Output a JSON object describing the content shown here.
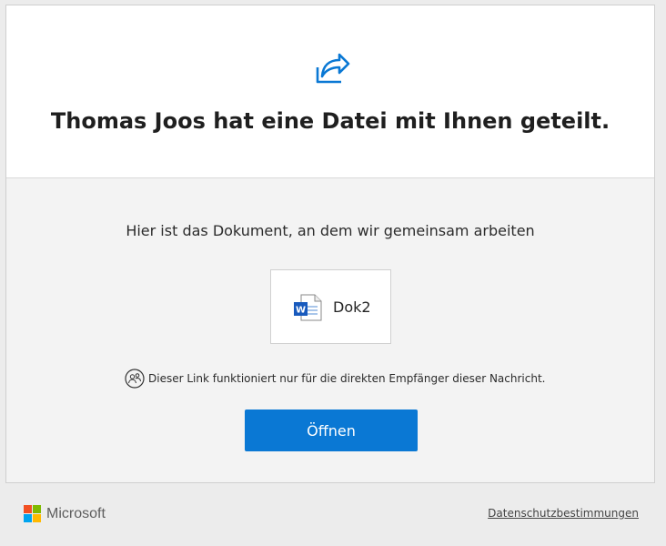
{
  "header": {
    "share_icon": "share-arrow-icon",
    "title": "Thomas Joos hat eine Datei mit Ihnen geteilt."
  },
  "body": {
    "message": "Hier ist das Dokument, an dem wir gemeinsam arbeiten",
    "document": {
      "icon": "word-document-icon",
      "name": "Dok2"
    },
    "link_notice": {
      "icon": "people-icon",
      "text": "Dieser Link funktioniert nur für die direkten Empfänger dieser Nachricht."
    },
    "open_button_label": "Öffnen"
  },
  "footer": {
    "brand": "Microsoft",
    "privacy_link": "Datenschutzbestimmungen"
  },
  "colors": {
    "accent": "#0a78d4",
    "ms_red": "#f25022",
    "ms_green": "#7fba00",
    "ms_blue": "#00a4ef",
    "ms_yellow": "#ffb900"
  }
}
